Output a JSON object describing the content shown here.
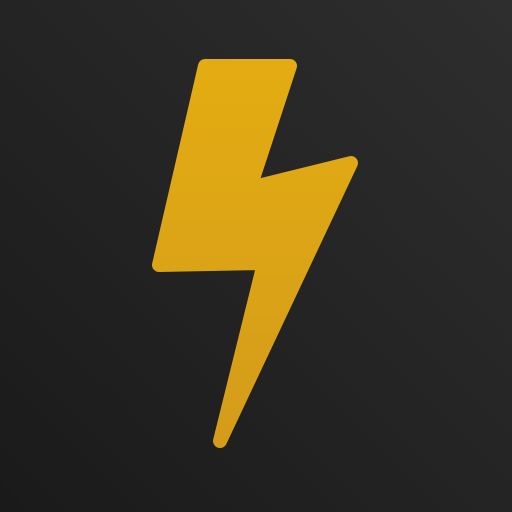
{
  "icon": {
    "name": "lightning-bolt-icon"
  },
  "colors": {
    "background_top_right": "#2e2e2e",
    "background_bottom_left": "#1a1a1a",
    "bolt_top": "#e3ac12",
    "bolt_bottom": "#d49c1a"
  }
}
